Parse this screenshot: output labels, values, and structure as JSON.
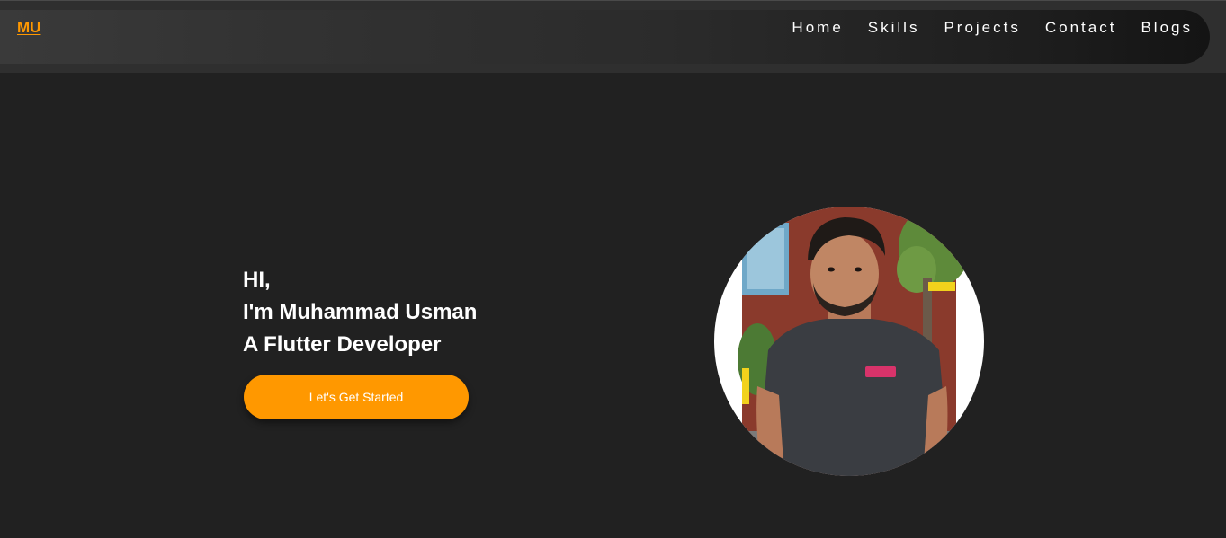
{
  "header": {
    "logo": "MU",
    "nav": [
      {
        "label": "Home"
      },
      {
        "label": "Skills"
      },
      {
        "label": "Projects"
      },
      {
        "label": "Contact"
      },
      {
        "label": "Blogs"
      }
    ]
  },
  "hero": {
    "greeting": "HI,",
    "name_line": "I'm Muhammad Usman",
    "role_line": "A Flutter Developer",
    "cta_label": "Let's Get Started"
  },
  "colors": {
    "accent": "#ff9800",
    "background": "#212121",
    "text": "#ffffff"
  }
}
